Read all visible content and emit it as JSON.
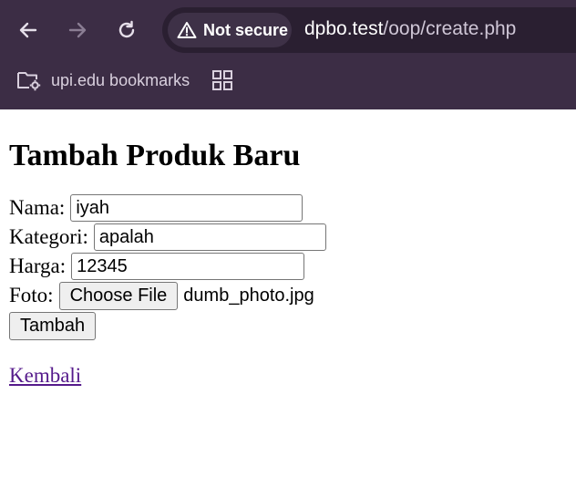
{
  "browser": {
    "security_label": "Not secure",
    "url_host": "dpbo.test",
    "url_path": "/oop/create.php",
    "bookmark_folder": "upi.edu bookmarks",
    "icons": {
      "back": "back-arrow-icon",
      "forward": "forward-arrow-icon",
      "reload": "reload-icon",
      "warning": "warning-triangle-icon",
      "folder": "folder-settings-icon",
      "apps": "apps-grid-icon"
    },
    "colors": {
      "toolbar": "#3c2d45",
      "omnibox": "#2a1f31",
      "chip": "#3e3147"
    }
  },
  "page": {
    "title": "Tambah Produk Baru",
    "form": {
      "nama_label": "Nama:",
      "nama_value": "iyah",
      "kategori_label": "Kategori:",
      "kategori_value": "apalah",
      "harga_label": "Harga:",
      "harga_value": "12345",
      "foto_label": "Foto:",
      "choose_file_label": "Choose File",
      "file_name": "dumb_photo.jpg",
      "submit_label": "Tambah"
    },
    "back_link": "Kembali",
    "link_color": "#551a8b"
  }
}
